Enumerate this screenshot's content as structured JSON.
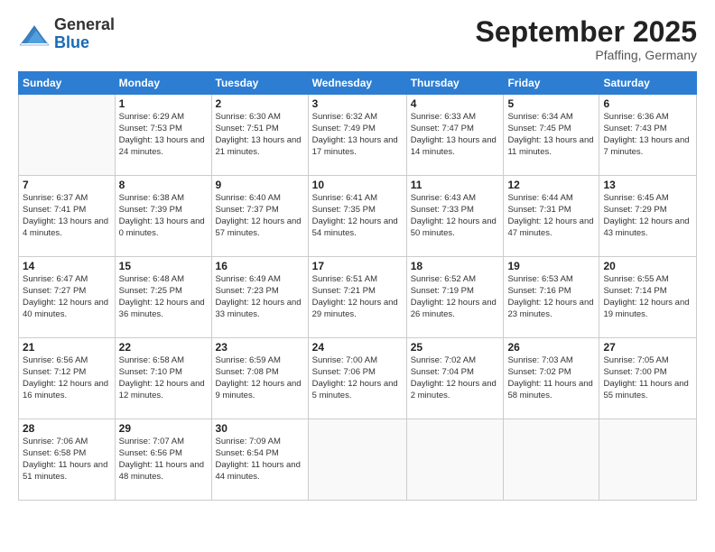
{
  "logo": {
    "general": "General",
    "blue": "Blue"
  },
  "header": {
    "month": "September 2025",
    "location": "Pfaffing, Germany"
  },
  "weekdays": [
    "Sunday",
    "Monday",
    "Tuesday",
    "Wednesday",
    "Thursday",
    "Friday",
    "Saturday"
  ],
  "weeks": [
    [
      {
        "day": "",
        "sunrise": "",
        "sunset": "",
        "daylight": ""
      },
      {
        "day": "1",
        "sunrise": "Sunrise: 6:29 AM",
        "sunset": "Sunset: 7:53 PM",
        "daylight": "Daylight: 13 hours and 24 minutes."
      },
      {
        "day": "2",
        "sunrise": "Sunrise: 6:30 AM",
        "sunset": "Sunset: 7:51 PM",
        "daylight": "Daylight: 13 hours and 21 minutes."
      },
      {
        "day": "3",
        "sunrise": "Sunrise: 6:32 AM",
        "sunset": "Sunset: 7:49 PM",
        "daylight": "Daylight: 13 hours and 17 minutes."
      },
      {
        "day": "4",
        "sunrise": "Sunrise: 6:33 AM",
        "sunset": "Sunset: 7:47 PM",
        "daylight": "Daylight: 13 hours and 14 minutes."
      },
      {
        "day": "5",
        "sunrise": "Sunrise: 6:34 AM",
        "sunset": "Sunset: 7:45 PM",
        "daylight": "Daylight: 13 hours and 11 minutes."
      },
      {
        "day": "6",
        "sunrise": "Sunrise: 6:36 AM",
        "sunset": "Sunset: 7:43 PM",
        "daylight": "Daylight: 13 hours and 7 minutes."
      }
    ],
    [
      {
        "day": "7",
        "sunrise": "Sunrise: 6:37 AM",
        "sunset": "Sunset: 7:41 PM",
        "daylight": "Daylight: 13 hours and 4 minutes."
      },
      {
        "day": "8",
        "sunrise": "Sunrise: 6:38 AM",
        "sunset": "Sunset: 7:39 PM",
        "daylight": "Daylight: 13 hours and 0 minutes."
      },
      {
        "day": "9",
        "sunrise": "Sunrise: 6:40 AM",
        "sunset": "Sunset: 7:37 PM",
        "daylight": "Daylight: 12 hours and 57 minutes."
      },
      {
        "day": "10",
        "sunrise": "Sunrise: 6:41 AM",
        "sunset": "Sunset: 7:35 PM",
        "daylight": "Daylight: 12 hours and 54 minutes."
      },
      {
        "day": "11",
        "sunrise": "Sunrise: 6:43 AM",
        "sunset": "Sunset: 7:33 PM",
        "daylight": "Daylight: 12 hours and 50 minutes."
      },
      {
        "day": "12",
        "sunrise": "Sunrise: 6:44 AM",
        "sunset": "Sunset: 7:31 PM",
        "daylight": "Daylight: 12 hours and 47 minutes."
      },
      {
        "day": "13",
        "sunrise": "Sunrise: 6:45 AM",
        "sunset": "Sunset: 7:29 PM",
        "daylight": "Daylight: 12 hours and 43 minutes."
      }
    ],
    [
      {
        "day": "14",
        "sunrise": "Sunrise: 6:47 AM",
        "sunset": "Sunset: 7:27 PM",
        "daylight": "Daylight: 12 hours and 40 minutes."
      },
      {
        "day": "15",
        "sunrise": "Sunrise: 6:48 AM",
        "sunset": "Sunset: 7:25 PM",
        "daylight": "Daylight: 12 hours and 36 minutes."
      },
      {
        "day": "16",
        "sunrise": "Sunrise: 6:49 AM",
        "sunset": "Sunset: 7:23 PM",
        "daylight": "Daylight: 12 hours and 33 minutes."
      },
      {
        "day": "17",
        "sunrise": "Sunrise: 6:51 AM",
        "sunset": "Sunset: 7:21 PM",
        "daylight": "Daylight: 12 hours and 29 minutes."
      },
      {
        "day": "18",
        "sunrise": "Sunrise: 6:52 AM",
        "sunset": "Sunset: 7:19 PM",
        "daylight": "Daylight: 12 hours and 26 minutes."
      },
      {
        "day": "19",
        "sunrise": "Sunrise: 6:53 AM",
        "sunset": "Sunset: 7:16 PM",
        "daylight": "Daylight: 12 hours and 23 minutes."
      },
      {
        "day": "20",
        "sunrise": "Sunrise: 6:55 AM",
        "sunset": "Sunset: 7:14 PM",
        "daylight": "Daylight: 12 hours and 19 minutes."
      }
    ],
    [
      {
        "day": "21",
        "sunrise": "Sunrise: 6:56 AM",
        "sunset": "Sunset: 7:12 PM",
        "daylight": "Daylight: 12 hours and 16 minutes."
      },
      {
        "day": "22",
        "sunrise": "Sunrise: 6:58 AM",
        "sunset": "Sunset: 7:10 PM",
        "daylight": "Daylight: 12 hours and 12 minutes."
      },
      {
        "day": "23",
        "sunrise": "Sunrise: 6:59 AM",
        "sunset": "Sunset: 7:08 PM",
        "daylight": "Daylight: 12 hours and 9 minutes."
      },
      {
        "day": "24",
        "sunrise": "Sunrise: 7:00 AM",
        "sunset": "Sunset: 7:06 PM",
        "daylight": "Daylight: 12 hours and 5 minutes."
      },
      {
        "day": "25",
        "sunrise": "Sunrise: 7:02 AM",
        "sunset": "Sunset: 7:04 PM",
        "daylight": "Daylight: 12 hours and 2 minutes."
      },
      {
        "day": "26",
        "sunrise": "Sunrise: 7:03 AM",
        "sunset": "Sunset: 7:02 PM",
        "daylight": "Daylight: 11 hours and 58 minutes."
      },
      {
        "day": "27",
        "sunrise": "Sunrise: 7:05 AM",
        "sunset": "Sunset: 7:00 PM",
        "daylight": "Daylight: 11 hours and 55 minutes."
      }
    ],
    [
      {
        "day": "28",
        "sunrise": "Sunrise: 7:06 AM",
        "sunset": "Sunset: 6:58 PM",
        "daylight": "Daylight: 11 hours and 51 minutes."
      },
      {
        "day": "29",
        "sunrise": "Sunrise: 7:07 AM",
        "sunset": "Sunset: 6:56 PM",
        "daylight": "Daylight: 11 hours and 48 minutes."
      },
      {
        "day": "30",
        "sunrise": "Sunrise: 7:09 AM",
        "sunset": "Sunset: 6:54 PM",
        "daylight": "Daylight: 11 hours and 44 minutes."
      },
      {
        "day": "",
        "sunrise": "",
        "sunset": "",
        "daylight": ""
      },
      {
        "day": "",
        "sunrise": "",
        "sunset": "",
        "daylight": ""
      },
      {
        "day": "",
        "sunrise": "",
        "sunset": "",
        "daylight": ""
      },
      {
        "day": "",
        "sunrise": "",
        "sunset": "",
        "daylight": ""
      }
    ]
  ]
}
